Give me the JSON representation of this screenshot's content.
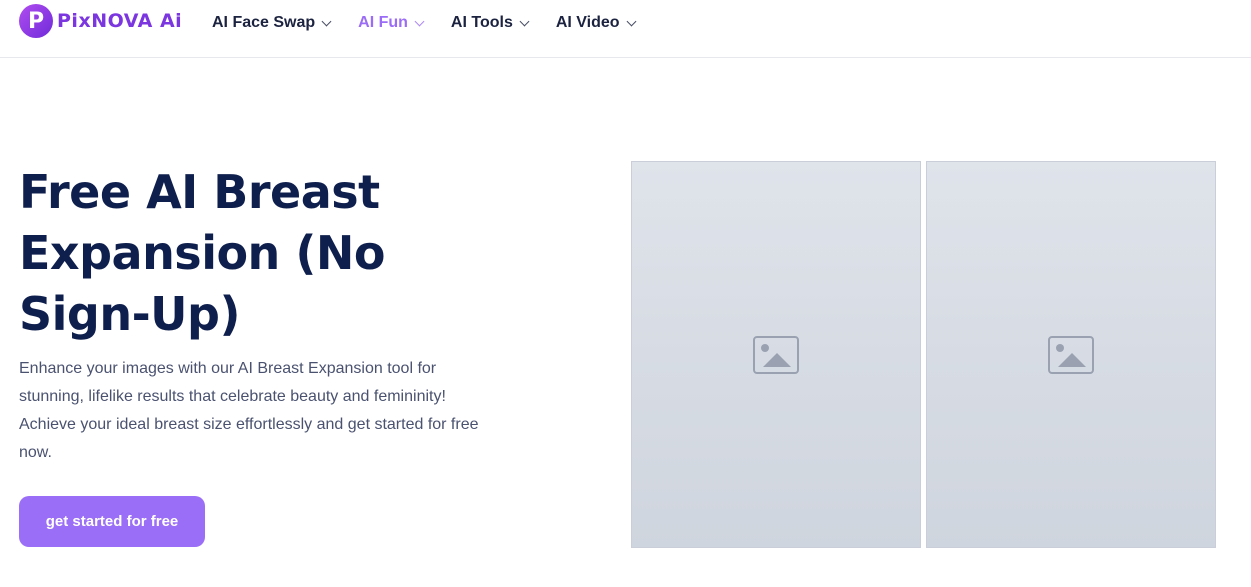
{
  "brand": {
    "logo_letter": "P",
    "name": "PixNOVA Ai",
    "accent": "#9a6ef6"
  },
  "nav": {
    "items": [
      {
        "label": "AI Face Swap"
      },
      {
        "label": "AI Fun"
      },
      {
        "label": "AI Tools"
      },
      {
        "label": "AI Video"
      }
    ]
  },
  "hero": {
    "title": "Free AI Breast Expansion (No Sign-Up)",
    "description": "Enhance your images with our AI Breast Expansion tool for stunning, lifelike results that celebrate beauty and femininity! Achieve your ideal breast size effortlessly and get started for free now.",
    "cta_label": "get started for free"
  },
  "colors": {
    "title": "#0f1f4d",
    "text": "#4a5270",
    "active_nav": "#9b6cf5"
  }
}
